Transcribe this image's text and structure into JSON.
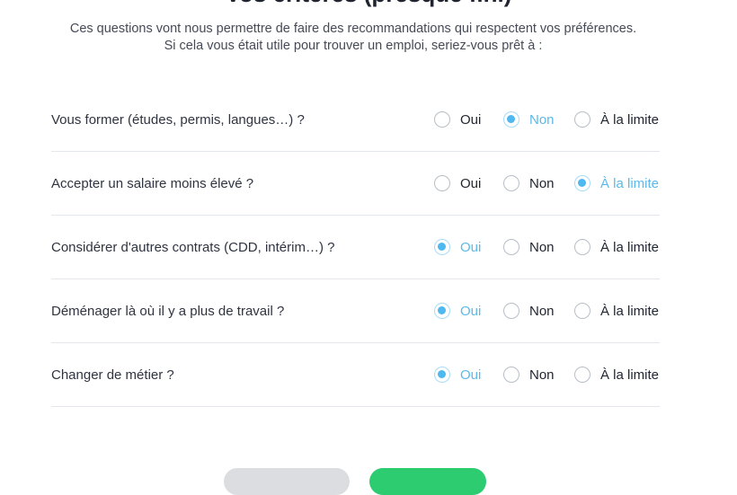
{
  "header": {
    "title": "Vos critères (presque fini)",
    "intro_line1": "Ces questions vont nous permettre de faire des recommandations qui respectent vos préférences.",
    "intro_line2": "Si cela vous était utile pour trouver un emploi, seriez-vous prêt à :"
  },
  "options": [
    "Oui",
    "Non",
    "À la limite"
  ],
  "questions": [
    {
      "label": "Vous former (études, permis, langues…) ?",
      "selected": "Non"
    },
    {
      "label": "Accepter un salaire moins élevé ?",
      "selected": "À la limite"
    },
    {
      "label": "Considérer d'autres contrats (CDD, intérim…) ?",
      "selected": "Oui"
    },
    {
      "label": "Déménager là où il y a plus de travail ?",
      "selected": "Oui"
    },
    {
      "label": "Changer de métier ?",
      "selected": "Oui"
    }
  ],
  "colors": {
    "selected_accent": "#4fb8ef",
    "primary_button": "#2ecc71",
    "secondary_button": "#dcdde1"
  }
}
